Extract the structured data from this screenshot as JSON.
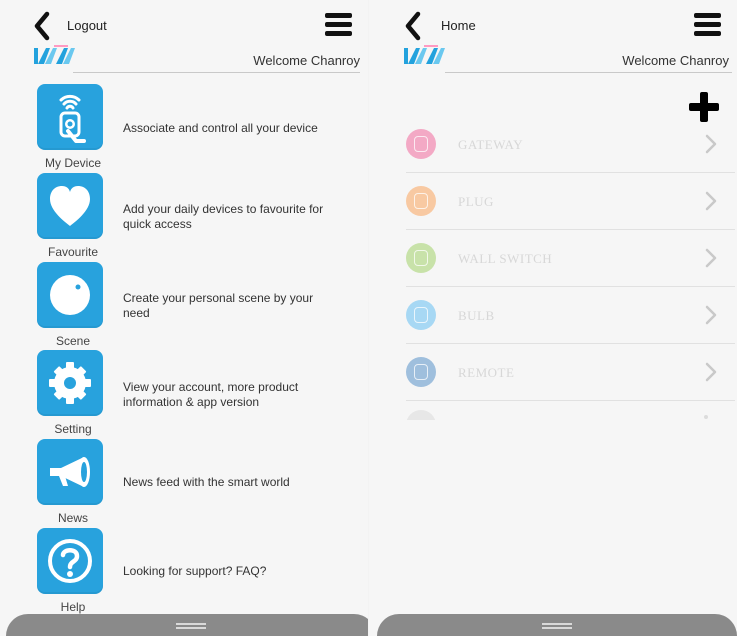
{
  "colors": {
    "accent": "#28a2dd",
    "background": "#f6f6f6",
    "menu_line": "#111111",
    "device_text": "#d7d7d7",
    "handle": "#8a8a8a"
  },
  "left_screen": {
    "header": {
      "back_label": "Logout",
      "back_icon": "chevron-left-icon",
      "menu_icon": "hamburger-menu-icon"
    },
    "brand": {
      "welcome_text": "Welcome Chanroy"
    },
    "menu_items": [
      {
        "icon": "wifi-device-icon",
        "label": "My Device",
        "description_line1": "Associate and control all your device",
        "description_line2": ""
      },
      {
        "icon": "heart-icon",
        "label": "Favourite",
        "description_line1": "Add your daily devices to favourite for",
        "description_line2": "quick access"
      },
      {
        "icon": "scene-icon",
        "label": "Scene",
        "description_line1": "Create your personal scene by your",
        "description_line2": "need"
      },
      {
        "icon": "gear-icon",
        "label": "Setting",
        "description_line1": "View your account, more product",
        "description_line2": "information & app version"
      },
      {
        "icon": "megaphone-icon",
        "label": "News",
        "description_line1": "News feed with the smart world",
        "description_line2": ""
      },
      {
        "icon": "help-icon",
        "label": "Help",
        "description_line1": "Looking for support? FAQ?",
        "description_line2": ""
      }
    ]
  },
  "right_screen": {
    "header": {
      "back_label": "Home",
      "back_icon": "chevron-left-icon",
      "menu_icon": "hamburger-menu-icon"
    },
    "brand": {
      "welcome_text": "Welcome Chanroy"
    },
    "add_icon": "plus-icon",
    "devices": [
      {
        "name": "GATEWAY",
        "icon_color": "#f3a9c5"
      },
      {
        "name": "PLUG",
        "icon_color": "#f8c9a2"
      },
      {
        "name": "WALL SWITCH",
        "icon_color": "#c8e2a9"
      },
      {
        "name": "BULB",
        "icon_color": "#a7d8f4"
      },
      {
        "name": "REMOTE",
        "icon_color": "#9fbfdd"
      }
    ]
  }
}
